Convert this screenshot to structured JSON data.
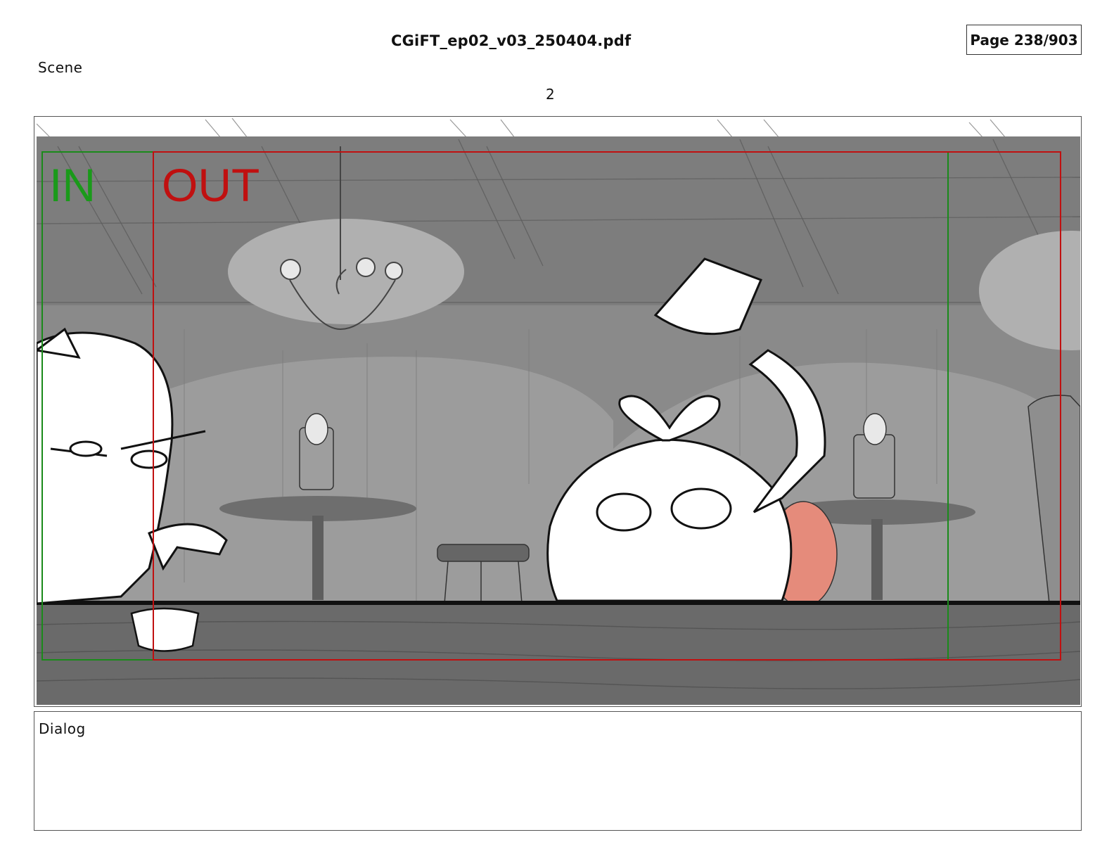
{
  "document": {
    "filename": "CGiFT_ep02_v03_250404.pdf",
    "page_label": "Page 238/903"
  },
  "scene": {
    "label": "Scene",
    "number": "2"
  },
  "panel": {
    "in_marker": "IN",
    "out_marker": "OUT",
    "in_color": "#1a9a1a",
    "out_color": "#c01010"
  },
  "dialog": {
    "label": "Dialog",
    "text": ""
  }
}
